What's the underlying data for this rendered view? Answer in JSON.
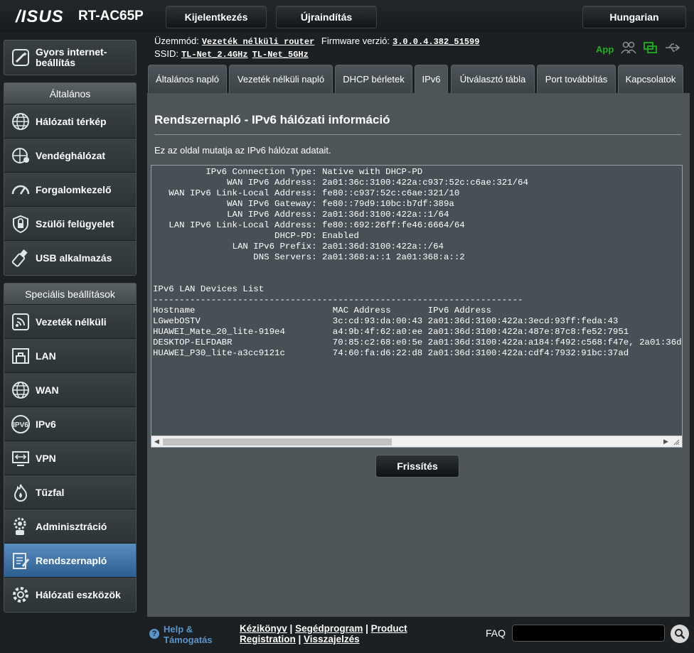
{
  "header": {
    "brand": "/ISUS",
    "model": "RT-AC65P",
    "logout_label": "Kijelentkezés",
    "reboot_label": "Újraindítás",
    "language": "Hungarian"
  },
  "status": {
    "mode_label": "Üzemmód:",
    "mode_value": "Vezeték nélküli router",
    "firmware_label": "Firmware verzió:",
    "firmware_value": "3.0.0.4.382_51599",
    "ssid_label": "SSID:",
    "ssid_24": "TL-Net_2.4GHz",
    "ssid_5": "TL-Net_5GHz",
    "app_label": "App"
  },
  "sidebar": {
    "quick_setup": "Gyors internet-beállítás",
    "general_title": "Általános",
    "general_items": [
      {
        "label": "Hálózati térkép",
        "icon": "globe-network-icon"
      },
      {
        "label": "Vendéghálózat",
        "icon": "guest-network-icon"
      },
      {
        "label": "Forgalomkezelő",
        "icon": "speedometer-icon"
      },
      {
        "label": "Szülői felügyelet",
        "icon": "parental-lock-icon"
      },
      {
        "label": "USB alkalmazás",
        "icon": "usb-icon"
      }
    ],
    "advanced_title": "Speciális beállítások",
    "advanced_items": [
      {
        "label": "Vezeték nélküli",
        "icon": "wireless-icon"
      },
      {
        "label": "LAN",
        "icon": "lan-icon"
      },
      {
        "label": "WAN",
        "icon": "wan-globe-icon"
      },
      {
        "label": "IPv6",
        "icon": "ipv6-icon"
      },
      {
        "label": "VPN",
        "icon": "vpn-icon"
      },
      {
        "label": "Tűzfal",
        "icon": "firewall-icon"
      },
      {
        "label": "Adminisztráció",
        "icon": "admin-gear-icon"
      },
      {
        "label": "Rendszernapló",
        "icon": "system-log-icon"
      },
      {
        "label": "Hálózati eszközök",
        "icon": "network-tools-icon"
      }
    ]
  },
  "tabs": [
    {
      "label": "Általános napló"
    },
    {
      "label": "Vezeték nélküli napló"
    },
    {
      "label": "DHCP bérletek"
    },
    {
      "label": "IPv6"
    },
    {
      "label": "Útválasztó tábla"
    },
    {
      "label": "Port továbbítás"
    },
    {
      "label": "Kapcsolatok"
    }
  ],
  "content": {
    "title": "Rendszernapló - IPv6 hálózati információ",
    "description": "Ez az oldal mutatja az IPv6 hálózat adatait.",
    "log": "          IPv6 Connection Type: Native with DHCP-PD\n              WAN IPv6 Address: 2a01:36c:3100:422a:c937:52c:c6ae:321/64\n   WAN IPv6 Link-Local Address: fe80::c937:52c:c6ae:321/10\n              WAN IPv6 Gateway: fe80::79d9:10bc:b7df:389a\n              LAN IPv6 Address: 2a01:36d:3100:422a::1/64\n   LAN IPv6 Link-Local Address: fe80::692:26ff:fe46:6664/64\n                       DHCP-PD: Enabled\n               LAN IPv6 Prefix: 2a01:36d:3100:422a::/64\n                   DNS Servers: 2a01:368:a::1 2a01:368:a::2\n\n\nIPv6 LAN Devices List\n----------------------------------------------------------------------\nHostname                          MAC Address       IPv6 Address\nLGwebOSTV                         3c:cd:93:da:00:43 2a01:36d:3100:422a:3ecd:93ff:feda:43\nHUAWEI_Mate_20_lite-919e4         a4:9b:4f:62:a0:ee 2a01:36d:3100:422a:487e:87c8:fe52:7951\nDESKTOP-ELFDABR                   70:85:c2:68:e0:5e 2a01:36d:3100:422a:a184:f492:c568:f47e, 2a01:36d\nHUAWEI_P30_lite-a3cc9121c         74:60:fa:d6:22:d8 2a01:36d:3100:422a:cdf4:7932:91bc:37ad",
    "refresh_label": "Frissítés"
  },
  "footer": {
    "help_label": "Help & Támogatás",
    "link_manual": "Kézikönyv",
    "link_utility": "Segédprogram",
    "link_product_registration": "Product Registration",
    "link_feedback": "Visszajelzés",
    "faq_label": "FAQ"
  },
  "colors": {
    "accent_blue": "#5a94c8",
    "app_green": "#20b020",
    "active_menu": "#3f74a6"
  }
}
